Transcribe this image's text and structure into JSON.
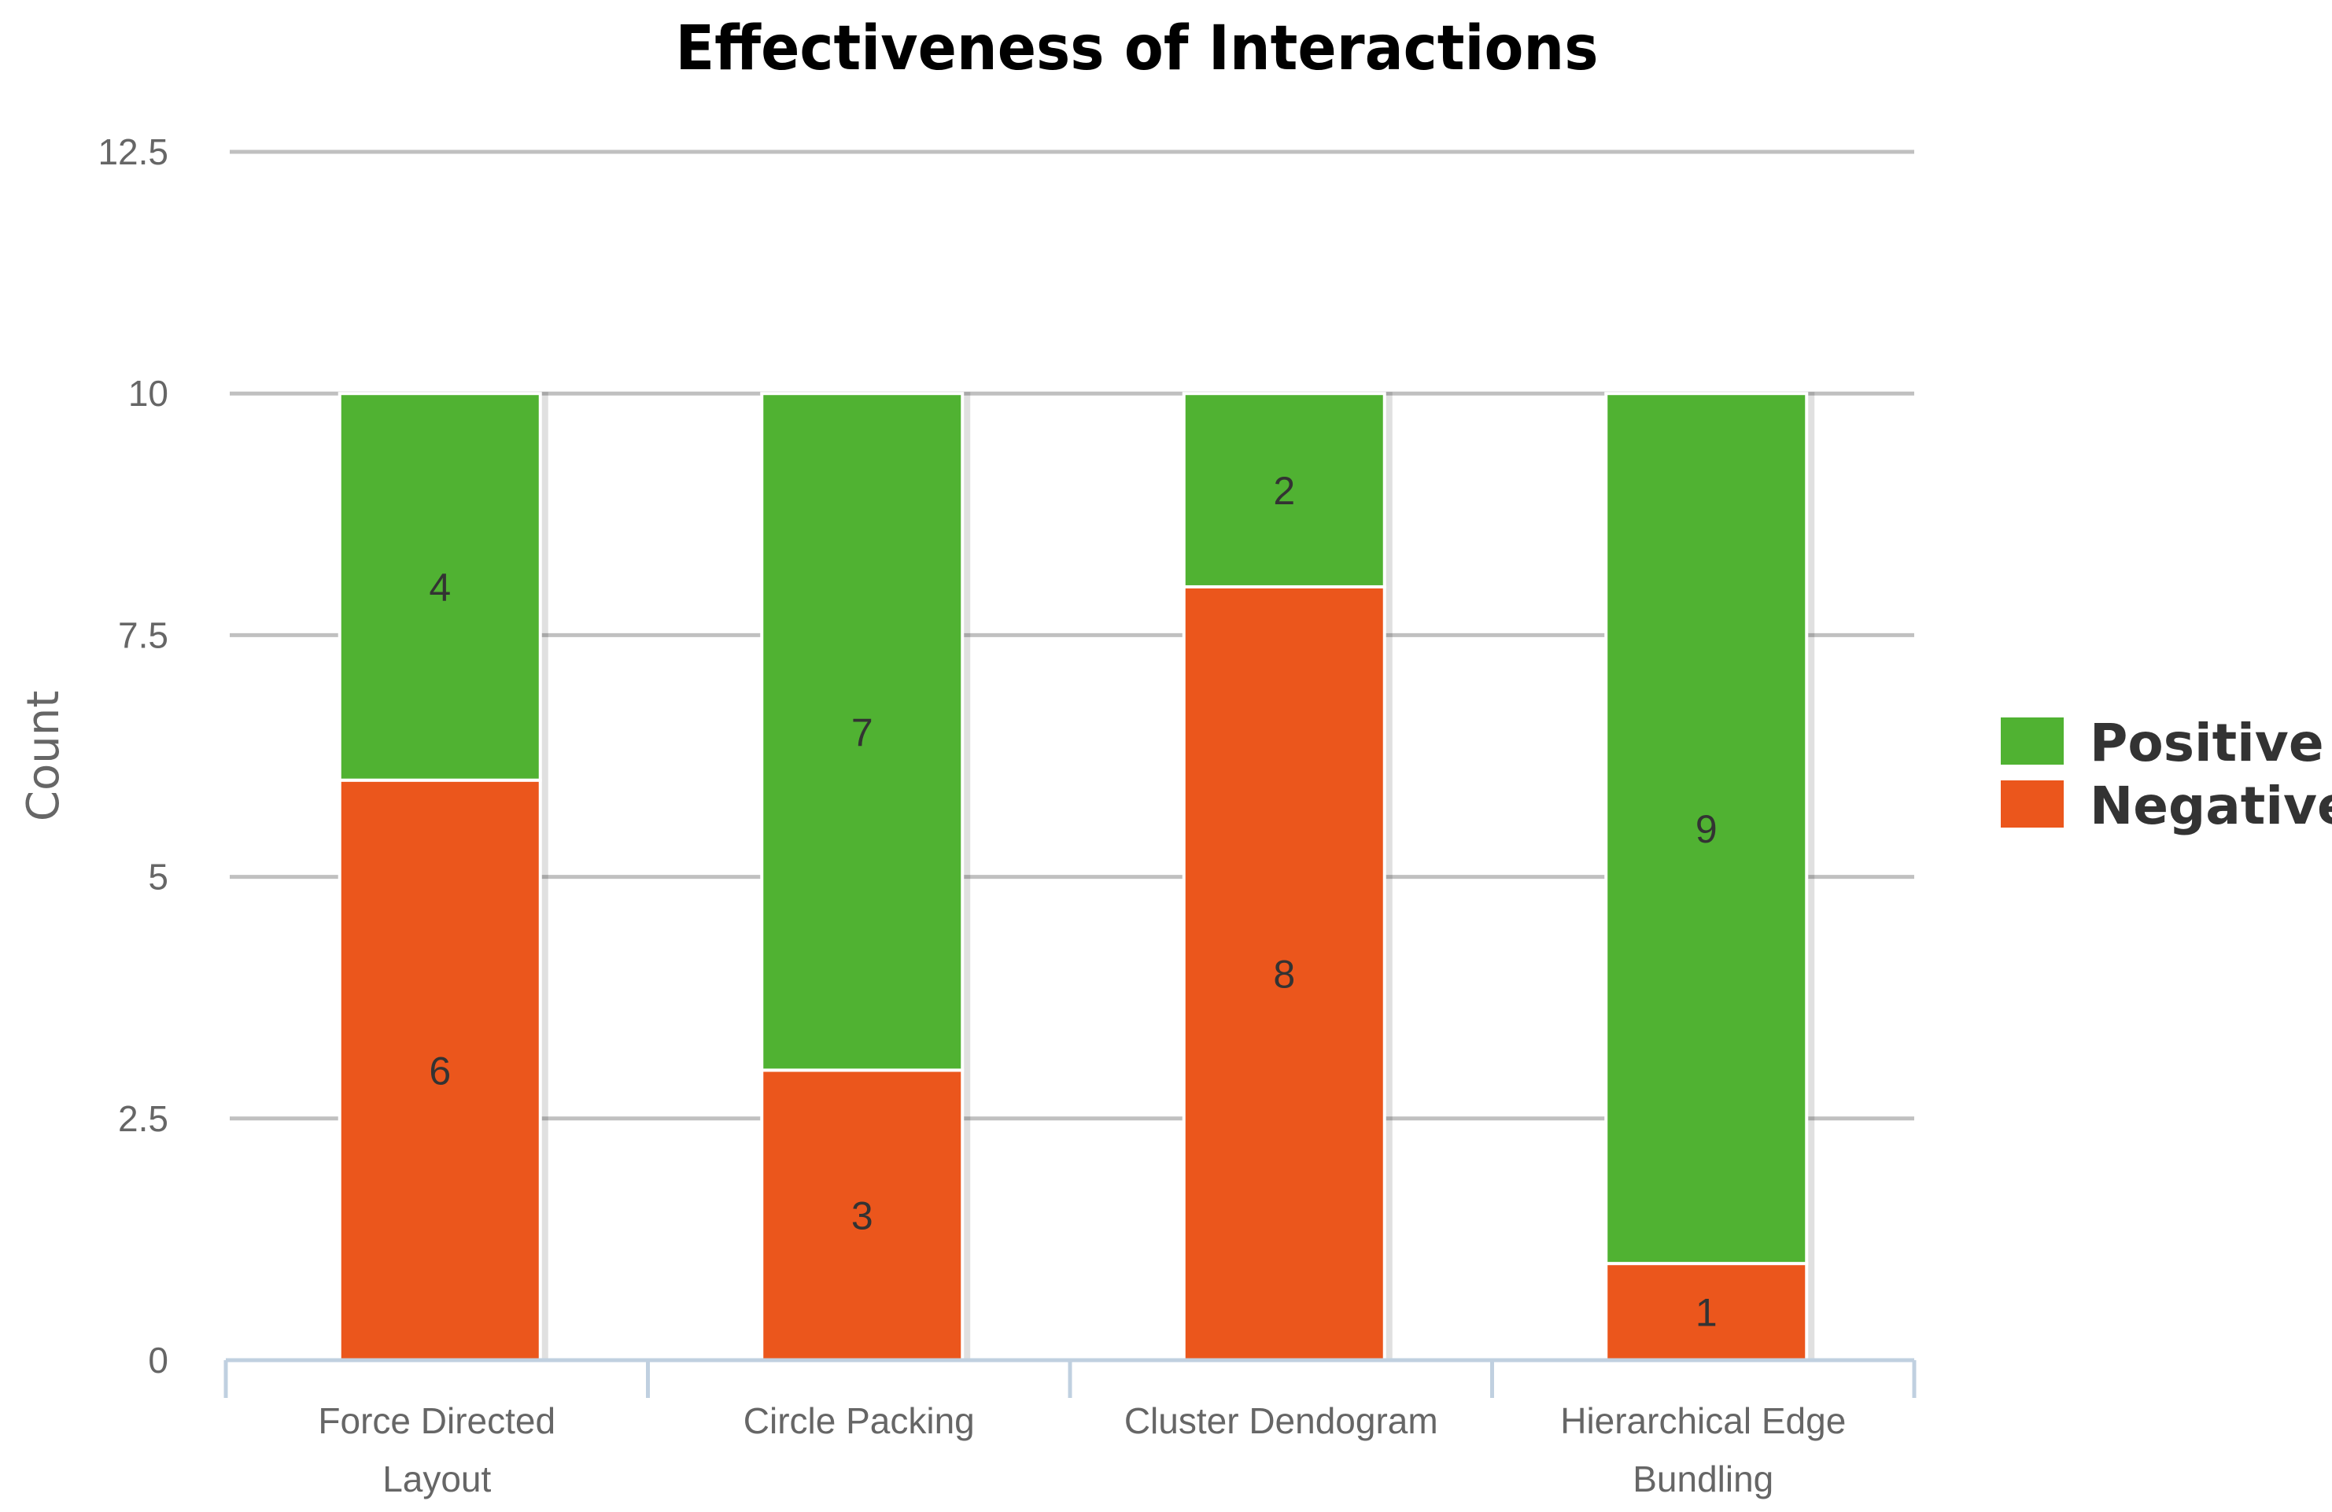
{
  "chart_data": {
    "type": "bar",
    "stacked": true,
    "title": "Effectiveness of Interactions",
    "xlabel": "",
    "ylabel": "Count",
    "ylim": [
      0,
      12.5
    ],
    "yticks": [
      0,
      2.5,
      5,
      7.5,
      10,
      12.5
    ],
    "ytick_labels": [
      "0",
      "2.5",
      "5",
      "7.5",
      "10",
      "12.5"
    ],
    "grid": true,
    "categories": [
      [
        "Force Directed",
        "Layout"
      ],
      [
        "Circle Packing"
      ],
      [
        "Cluster Dendogram"
      ],
      [
        "Hierarchical Edge",
        "Bundling"
      ]
    ],
    "category_names": [
      "Force Directed Layout",
      "Circle Packing",
      "Cluster Dendogram",
      "Hierarchical Edge Bundling"
    ],
    "series": [
      {
        "name": "Negative",
        "color": "#eb561c",
        "values": [
          6,
          3,
          8,
          1
        ]
      },
      {
        "name": "Positive",
        "color": "#50b232",
        "values": [
          4,
          7,
          2,
          9
        ]
      }
    ],
    "data_labels": true,
    "legend": {
      "position": "right",
      "entries": [
        {
          "name": "Positive",
          "color": "#50b232"
        },
        {
          "name": "Negative",
          "color": "#eb561c"
        }
      ]
    }
  }
}
